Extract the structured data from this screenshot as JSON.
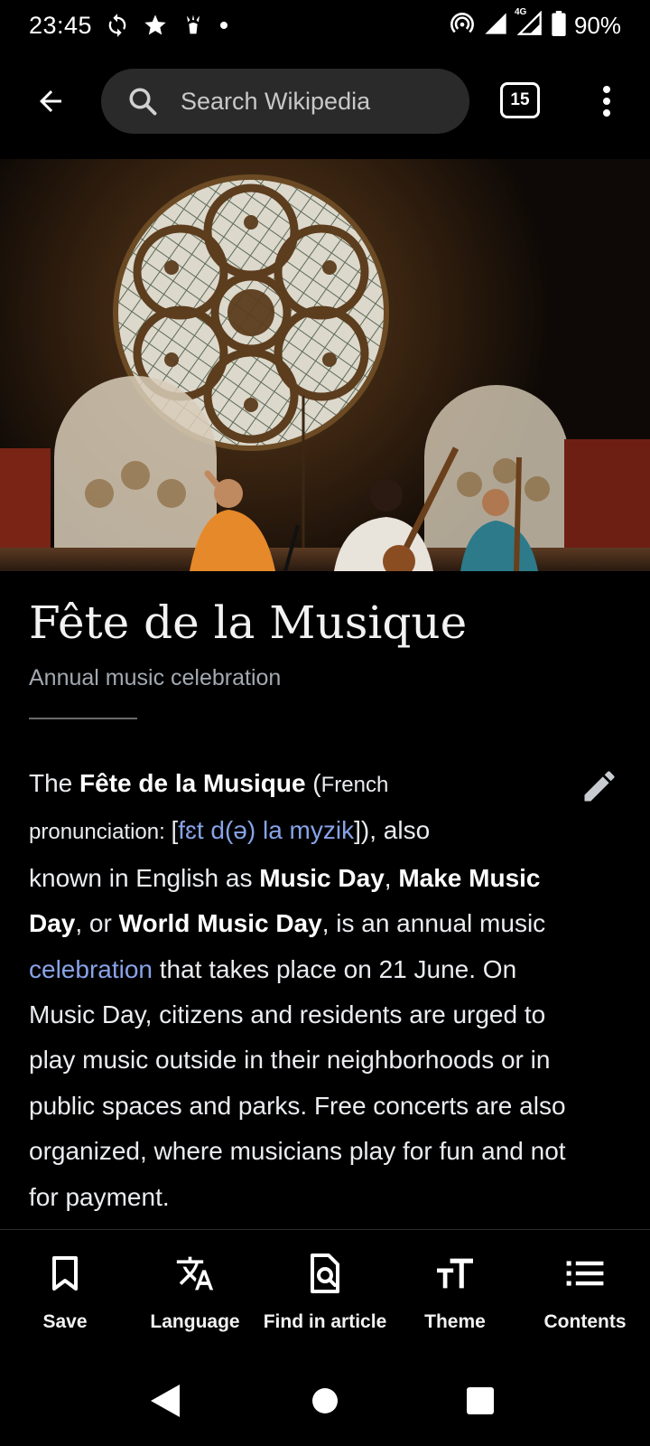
{
  "status_bar": {
    "time": "23:45",
    "network": "4G",
    "battery": "90%"
  },
  "top_bar": {
    "search_placeholder": "Search Wikipedia",
    "tab_count": "15"
  },
  "article": {
    "title": "Fête de la Musique",
    "description": "Annual music celebration",
    "body_lines": [
      [
        {
          "t": "The "
        },
        {
          "t": "Fête de la Musique",
          "b": true
        },
        {
          "t": " ("
        },
        {
          "t": "French",
          "s": true
        }
      ],
      [
        {
          "t": "pronunciation: ",
          "s": true
        },
        {
          "t": "["
        },
        {
          "t": "fɛt d(ə) la myzik",
          "l": true
        },
        {
          "t": "]), also"
        }
      ],
      [
        {
          "t": "known in English as "
        },
        {
          "t": "Music Day",
          "b": true
        },
        {
          "t": ", "
        },
        {
          "t": "Make Music",
          "b": true
        }
      ],
      [
        {
          "t": "Day",
          "b": true
        },
        {
          "t": ", or "
        },
        {
          "t": "World Music Day",
          "b": true
        },
        {
          "t": ", is an annual music"
        }
      ],
      [
        {
          "t": "celebration",
          "l": true
        },
        {
          "t": " that takes place on 21 June. On"
        }
      ],
      [
        {
          "t": "Music Day, citizens and residents are urged to"
        }
      ],
      [
        {
          "t": "play music outside in their neighborhoods or in"
        }
      ],
      [
        {
          "t": "public spaces and parks. Free concerts are also"
        }
      ],
      [
        {
          "t": "organized, where musicians play for fun and not"
        }
      ],
      [
        {
          "t": "for payment."
        }
      ]
    ]
  },
  "toolbar": {
    "items": [
      {
        "label": "Save",
        "icon": "bookmark-icon"
      },
      {
        "label": "Language",
        "icon": "translate-icon"
      },
      {
        "label": "Find in article",
        "icon": "find-in-page-icon"
      },
      {
        "label": "Theme",
        "icon": "text-size-icon"
      },
      {
        "label": "Contents",
        "icon": "list-icon"
      }
    ]
  },
  "colors": {
    "background": "#000000",
    "link": "#88a3e8",
    "description": "#a2a9b1",
    "search_bg": "#2a2a2a"
  }
}
